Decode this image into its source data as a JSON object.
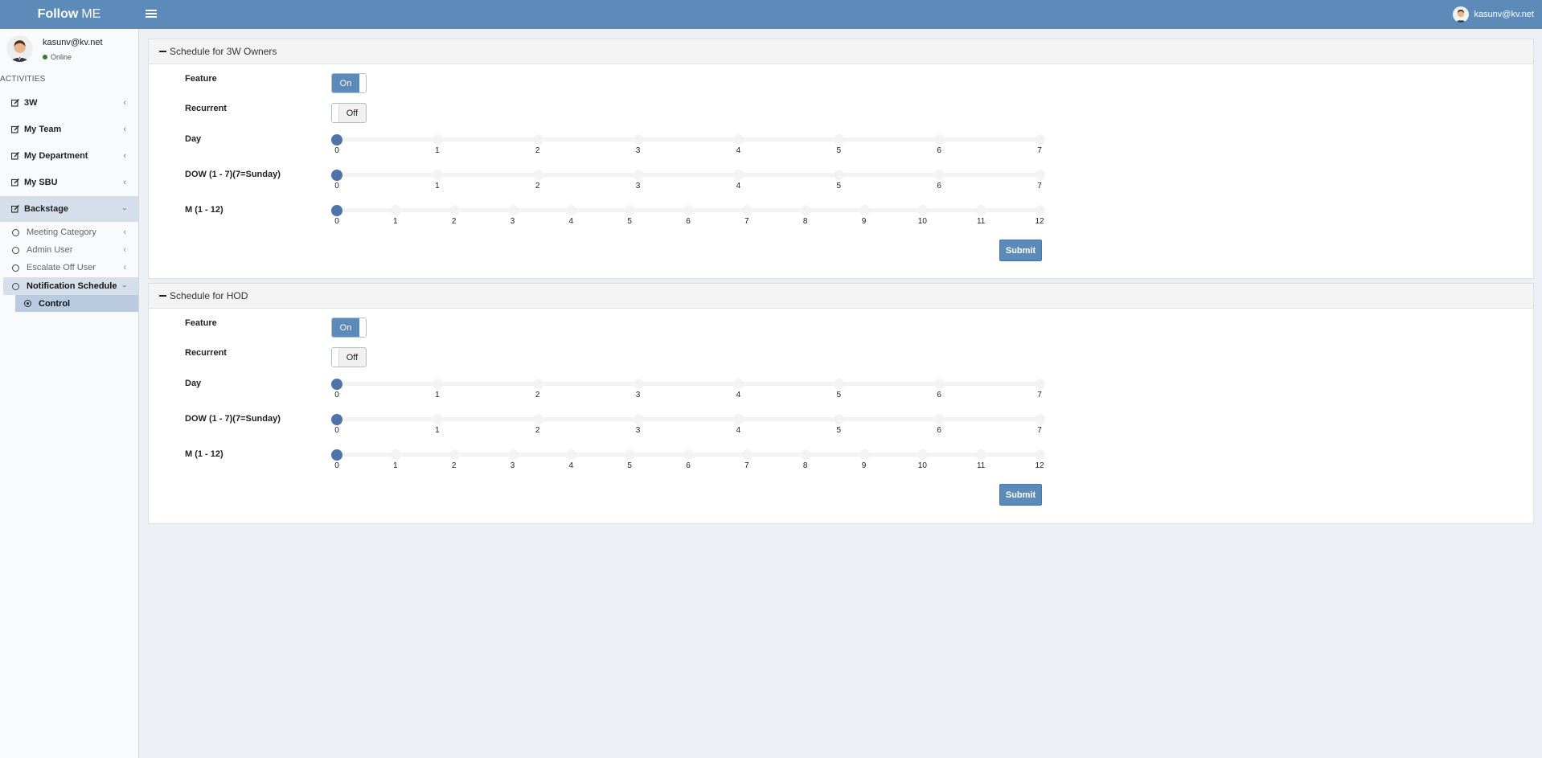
{
  "header": {
    "logo_bold": "Follow",
    "logo_rest": "ME",
    "user_email": "kasunv@kv.net"
  },
  "sidebar": {
    "user_name": "kasunv@kv.net",
    "user_status": "Online",
    "section_title": "ACTIVITIES",
    "items": [
      {
        "label": "3W"
      },
      {
        "label": "My Team"
      },
      {
        "label": "My Department"
      },
      {
        "label": "My SBU"
      },
      {
        "label": "Backstage"
      }
    ],
    "backstage_items": [
      {
        "label": "Meeting Category"
      },
      {
        "label": "Admin User"
      },
      {
        "label": "Escalate Off User"
      },
      {
        "label": "Notification Schedule"
      }
    ],
    "notification_items": [
      {
        "label": "Control"
      }
    ]
  },
  "panels": [
    {
      "title": "Schedule for 3W Owners",
      "feature_label": "Feature",
      "feature_value": "On",
      "recurrent_label": "Recurrent",
      "recurrent_value": "Off",
      "day_label": "Day",
      "day_value": 0,
      "dow_label": "DOW (1 - 7)(7=Sunday)",
      "dow_value": 0,
      "month_label": "M (1 - 12)",
      "month_value": 0,
      "submit_label": "Submit"
    },
    {
      "title": "Schedule for HOD",
      "feature_label": "Feature",
      "feature_value": "On",
      "recurrent_label": "Recurrent",
      "recurrent_value": "Off",
      "day_label": "Day",
      "day_value": 0,
      "dow_label": "DOW (1 - 7)(7=Sunday)",
      "dow_value": 0,
      "month_label": "M (1 - 12)",
      "month_value": 0,
      "submit_label": "Submit"
    }
  ],
  "sliders": {
    "day_ticks": [
      "0",
      "1",
      "2",
      "3",
      "4",
      "5",
      "6",
      "7"
    ],
    "dow_ticks": [
      "0",
      "1",
      "2",
      "3",
      "4",
      "5",
      "6",
      "7"
    ],
    "month_ticks": [
      "0",
      "1",
      "2",
      "3",
      "4",
      "5",
      "6",
      "7",
      "8",
      "9",
      "10",
      "11",
      "12"
    ]
  },
  "colors": {
    "brand": "#5d8bb9",
    "slider_handle": "#4d73a8",
    "status_online": "#3c763d"
  }
}
